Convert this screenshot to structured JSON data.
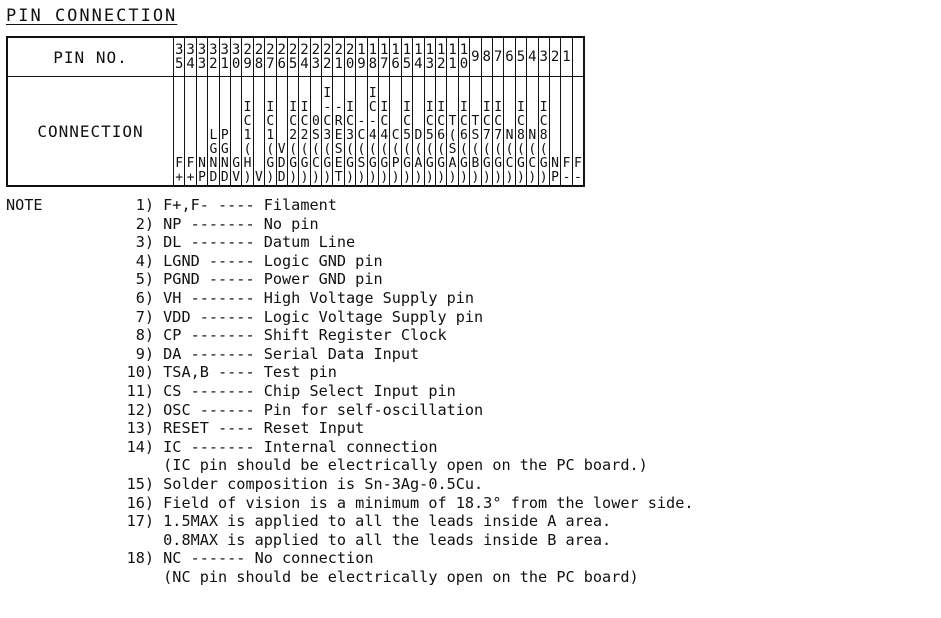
{
  "title": "PIN CONNECTION",
  "pin_header": "PIN NO.",
  "conn_header": "CONNECTION",
  "pins": [
    {
      "n": "35",
      "c": "F+"
    },
    {
      "n": "34",
      "c": "F+"
    },
    {
      "n": "33",
      "c": "NP"
    },
    {
      "n": "32",
      "c": "LGND"
    },
    {
      "n": "31",
      "c": "PGND"
    },
    {
      "n": "30",
      "c": "GV"
    },
    {
      "n": "29",
      "c": "IC1(H)"
    },
    {
      "n": "28",
      "c": "V"
    },
    {
      "n": "27",
      "c": "IC1(G)"
    },
    {
      "n": "26",
      "c": "VDD"
    },
    {
      "n": "25",
      "c": "IC2(G)"
    },
    {
      "n": "24",
      "c": "IC2(G)"
    },
    {
      "n": "23",
      "c": "0S(C)"
    },
    {
      "n": "22",
      "c": "I-C3(G)"
    },
    {
      "n": "21",
      "c": "-RESET"
    },
    {
      "n": "20",
      "c": "IC3(G)"
    },
    {
      "n": "19",
      "c": "-C(S)"
    },
    {
      "n": "18",
      "c": "IC-4(G)"
    },
    {
      "n": "17",
      "c": "IC4(G)"
    },
    {
      "n": "16",
      "c": "C(P)"
    },
    {
      "n": "15",
      "c": "IC5(G)"
    },
    {
      "n": "14",
      "c": "D(A)"
    },
    {
      "n": "13",
      "c": "IC5(G)"
    },
    {
      "n": "12",
      "c": "IC6(G)"
    },
    {
      "n": "11",
      "c": "T(SA)"
    },
    {
      "n": "10",
      "c": "IC6(G)"
    },
    {
      "n": "9",
      "c": "TS(B)"
    },
    {
      "n": "8",
      "c": "IC7(G)"
    },
    {
      "n": "7",
      "c": "IC7(G)"
    },
    {
      "n": "6",
      "c": "N(C)"
    },
    {
      "n": "5",
      "c": "IC8(G)"
    },
    {
      "n": "4",
      "c": "N(C)"
    },
    {
      "n": "3",
      "c": "IC8(G)"
    },
    {
      "n": "2",
      "c": "NP"
    },
    {
      "n": "1",
      "c": "F-"
    },
    {
      "n": "",
      "c": "F-"
    }
  ],
  "note_label": "NOTE",
  "notes": [
    {
      "num": "1)",
      "lead": "F+,F- ----",
      "text": "Filament"
    },
    {
      "num": "2)",
      "lead": "NP -------",
      "text": "No pin"
    },
    {
      "num": "3)",
      "lead": "DL -------",
      "text": "Datum Line"
    },
    {
      "num": "4)",
      "lead": "LGND -----",
      "text": "Logic GND pin"
    },
    {
      "num": "5)",
      "lead": "PGND -----",
      "text": "Power GND pin"
    },
    {
      "num": "6)",
      "lead": "VH -------",
      "text": "High Voltage Supply pin"
    },
    {
      "num": "7)",
      "lead": "VDD ------",
      "text": "Logic Voltage Supply pin"
    },
    {
      "num": "8)",
      "lead": "CP -------",
      "text": "Shift Register Clock"
    },
    {
      "num": "9)",
      "lead": "DA -------",
      "text": "Serial Data Input"
    },
    {
      "num": "10)",
      "lead": "TSA,B ----",
      "text": "Test pin"
    },
    {
      "num": "11)",
      "lead": "CS -------",
      "text": "Chip Select Input pin"
    },
    {
      "num": "12)",
      "lead": "OSC ------",
      "text": "Pin for self-oscillation"
    },
    {
      "num": "13)",
      "lead": "RESET ----",
      "text": "Reset Input"
    },
    {
      "num": "14)",
      "lead": "IC -------",
      "text": "Internal connection"
    },
    {
      "num": "",
      "lead": "",
      "text": "(IC pin should be electrically open on the PC board.)"
    },
    {
      "num": "15)",
      "lead": "",
      "text": "Solder composition is Sn-3Ag-0.5Cu."
    },
    {
      "num": "16)",
      "lead": "",
      "text": "Field of vision is a minimum of 18.3° from the lower side."
    },
    {
      "num": "17)",
      "lead": "",
      "text": "1.5MAX is applied to all the leads inside A area."
    },
    {
      "num": "",
      "lead": "",
      "text": "0.8MAX is applied to all the leads inside B area."
    },
    {
      "num": "18)",
      "lead": "NC ------",
      "text": "No connection"
    },
    {
      "num": "",
      "lead": "",
      "text": "(NC pin should be electrically open on the PC board)"
    }
  ]
}
